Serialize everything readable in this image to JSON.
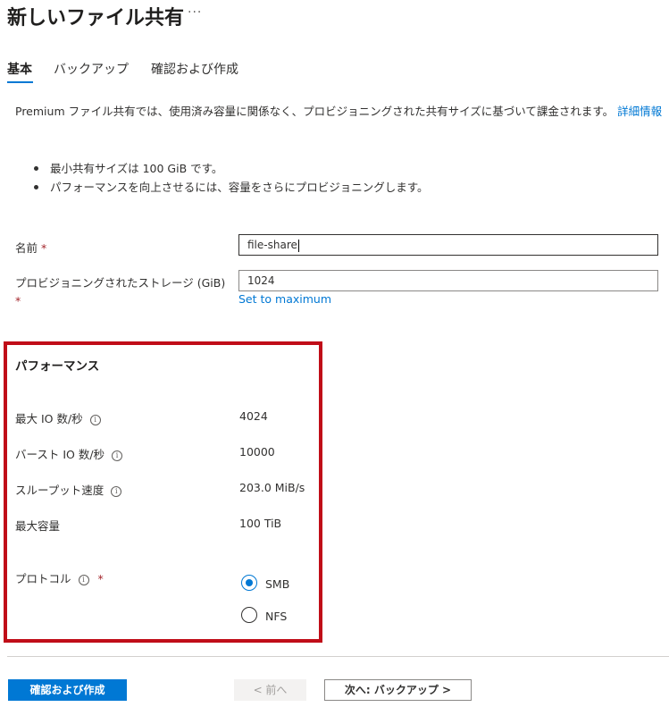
{
  "header": {
    "title": "新しいファイル共有",
    "more_label": "···"
  },
  "tabs": [
    {
      "label": "基本",
      "active": true
    },
    {
      "label": "バックアップ",
      "active": false
    },
    {
      "label": "確認および作成",
      "active": false
    }
  ],
  "intro": {
    "text": "Premium ファイル共有では、使用済み容量に関係なく、プロビジョニングされた共有サイズに基づいて課金されます。",
    "link_label": "詳細情報"
  },
  "bullets": [
    "最小共有サイズは 100 GiB です。",
    "パフォーマンスを向上させるには、容量をさらにプロビジョニングします。"
  ],
  "form": {
    "name_label": "名前",
    "name_value": "file-share",
    "storage_label": "プロビジョニングされたストレージ (GiB)",
    "storage_value": "1024",
    "set_max_label": "Set to maximum",
    "required_mark": "*"
  },
  "performance": {
    "title": "パフォーマンス",
    "max_iops_label": "最大 IO 数/秒",
    "max_iops_value": "4024",
    "burst_iops_label": "バースト IO 数/秒",
    "burst_iops_value": "10000",
    "throughput_label": "スループット速度",
    "throughput_value": "203.0 MiB/s",
    "max_capacity_label": "最大容量",
    "max_capacity_value": "100 TiB",
    "protocol_label": "プロトコル",
    "protocol_options": [
      {
        "label": "SMB",
        "selected": true
      },
      {
        "label": "NFS",
        "selected": false
      }
    ],
    "info_glyph": "i"
  },
  "footer": {
    "review_create_label": "確認および作成",
    "previous_label": "< 前へ",
    "next_label": "次へ: バックアップ >"
  },
  "colors": {
    "accent": "#0078d4",
    "highlight_border": "#c00d18",
    "required": "#a4262c"
  }
}
